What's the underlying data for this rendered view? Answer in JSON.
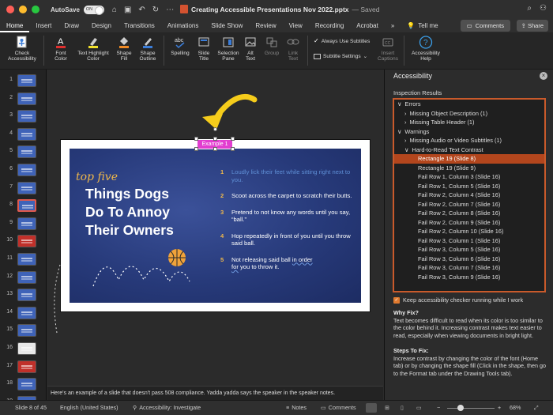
{
  "window": {
    "autosave_label": "AutoSave",
    "autosave_state": "ON",
    "doc_title": "Creating Accessible Presentations Nov 2022.pptx",
    "saved_status": "— Saved"
  },
  "tabs": [
    "Home",
    "Insert",
    "Draw",
    "Design",
    "Transitions",
    "Animations",
    "Slide Show",
    "Review",
    "View",
    "Recording",
    "Acrobat"
  ],
  "tell_me": "Tell me",
  "header_buttons": {
    "comments": "Comments",
    "share": "Share"
  },
  "ribbon": {
    "check_accessibility": "Check\nAccessibility",
    "font_color": "Font\nColor",
    "text_highlight_color": "Text Highlight\nColor",
    "shape_fill": "Shape\nFill",
    "shape_outline": "Shape\nOutline",
    "spelling": "Spelling",
    "slide_title": "Slide\nTitle",
    "selection_pane": "Selection\nPane",
    "alt_text": "Alt\nText",
    "group": "Group",
    "link_text": "Link\nText",
    "always_use_subtitles": "Always Use Subtitles",
    "subtitle_settings": "Subtitle Settings",
    "insert_captions": "Insert\nCaptions",
    "accessibility_help": "Accessibility\nHelp"
  },
  "thumbnails": [
    "1",
    "2",
    "3",
    "4",
    "5",
    "6",
    "7",
    "8",
    "9",
    "10",
    "11",
    "12",
    "13",
    "14",
    "15",
    "16",
    "17",
    "18",
    "19"
  ],
  "slide": {
    "example_label": "Example 1",
    "kicker": "top five",
    "headline": "Things Dogs\nDo To Annoy\nTheir Owners",
    "items": [
      {
        "num": "1",
        "text": "Loudly lick their feet while sitting right next to you."
      },
      {
        "num": "2",
        "text": "Scoot across the carpet to scratch their butts."
      },
      {
        "num": "3",
        "text": "Pretend to not know any words until you say, “ball.”"
      },
      {
        "num": "4",
        "text": "Hop repeatedly in front of you until you throw said ball."
      },
      {
        "num": "5",
        "text_a": "Not releasing said ball ",
        "text_b": "in order",
        "text_c": " for",
        "text_d": " you to throw it."
      }
    ]
  },
  "notes": "Here's an example of a slide that doesn't pass 508 compliance. Yadda yadda says the speaker in the speaker notes.",
  "accessibility_pane": {
    "title": "Accessibility",
    "inspection_results": "Inspection Results",
    "tree": [
      {
        "text": "Errors",
        "indent": 0,
        "arrow": "∨"
      },
      {
        "text": "Missing Object Description (1)",
        "indent": 1,
        "arrow": "›"
      },
      {
        "text": "Missing Table Header (1)",
        "indent": 1,
        "arrow": "›"
      },
      {
        "text": "Warnings",
        "indent": 0,
        "arrow": "∨"
      },
      {
        "text": "Missing Audio or Video Subtitles (1)",
        "indent": 1,
        "arrow": "›"
      },
      {
        "text": "Hard-to-Read Text Contrast",
        "indent": 1,
        "arrow": "∨"
      },
      {
        "text": "Rectangle 19  (Slide 8)",
        "indent": 2,
        "arrow": "",
        "selected": true
      },
      {
        "text": "Rectangle 19  (Slide 9)",
        "indent": 2,
        "arrow": ""
      },
      {
        "text": "Fail Row 1, Column 3  (Slide 16)",
        "indent": 2,
        "arrow": ""
      },
      {
        "text": "Fail Row 1, Column 5  (Slide 16)",
        "indent": 2,
        "arrow": ""
      },
      {
        "text": "Fail Row 2, Column 4  (Slide 16)",
        "indent": 2,
        "arrow": ""
      },
      {
        "text": "Fail Row 2, Column 7  (Slide 16)",
        "indent": 2,
        "arrow": ""
      },
      {
        "text": "Fail Row 2, Column 8  (Slide 16)",
        "indent": 2,
        "arrow": ""
      },
      {
        "text": "Fail Row 2, Column 9  (Slide 16)",
        "indent": 2,
        "arrow": ""
      },
      {
        "text": "Fail Row 2, Column 10  (Slide 16)",
        "indent": 2,
        "arrow": ""
      },
      {
        "text": "Fail Row 3, Column 1  (Slide 16)",
        "indent": 2,
        "arrow": ""
      },
      {
        "text": "Fail Row 3, Column 5  (Slide 16)",
        "indent": 2,
        "arrow": ""
      },
      {
        "text": "Fail Row 3, Column 6  (Slide 16)",
        "indent": 2,
        "arrow": ""
      },
      {
        "text": "Fail Row 3, Column 7  (Slide 16)",
        "indent": 2,
        "arrow": ""
      },
      {
        "text": "Fail Row 3, Column 9  (Slide 16)",
        "indent": 2,
        "arrow": ""
      }
    ],
    "keep_running": "Keep accessibility checker running while I work",
    "why_fix_title": "Why Fix?",
    "why_fix_text": "Text becomes difficult to read when its color is too similar to the color behind it. Increasing contrast makes text easier to read, especially when viewing documents in bright light.",
    "steps_title": "Steps To Fix:",
    "steps_text": "Increase contrast by changing the color of the font (Home tab) or by changing the shape fill (Click in the shape, then go to the Format tab under the Drawing Tools tab)."
  },
  "status": {
    "slide_of": "Slide 8 of 45",
    "language": "English (United States)",
    "accessibility": "Accessibility: Investigate",
    "notes": "Notes",
    "comments": "Comments",
    "zoom": "68%"
  },
  "colors": {
    "accent": "#c95a2b",
    "selected_row": "#b3461d",
    "label_magenta": "#e23dd0",
    "arrow_yellow": "#f5cc1b"
  }
}
